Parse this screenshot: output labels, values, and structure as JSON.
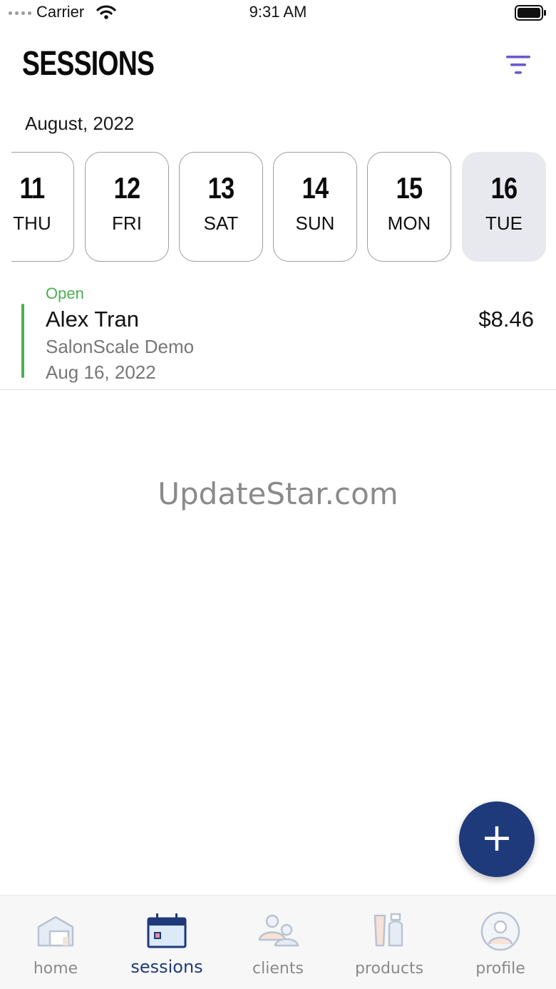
{
  "status_bar": {
    "carrier": "Carrier",
    "time": "9:31 AM"
  },
  "header": {
    "title": "SESSIONS",
    "filter_icon": "filter-icon",
    "accent_color": "#6a5acd"
  },
  "calendar": {
    "month": "August, 2022",
    "dates": [
      {
        "num": "11",
        "day": "THU",
        "selected": false
      },
      {
        "num": "12",
        "day": "FRI",
        "selected": false
      },
      {
        "num": "13",
        "day": "SAT",
        "selected": false
      },
      {
        "num": "14",
        "day": "SUN",
        "selected": false
      },
      {
        "num": "15",
        "day": "MON",
        "selected": false
      },
      {
        "num": "16",
        "day": "TUE",
        "selected": true
      }
    ]
  },
  "sessions": [
    {
      "status": "Open",
      "client": "Alex Tran",
      "salon": "SalonScale Demo",
      "date": "Aug 16, 2022",
      "amount": "$8.46",
      "status_color": "#4caf50"
    }
  ],
  "watermark": "UpdateStar.com",
  "fab": {
    "icon": "plus-icon",
    "color": "#1f3a7a"
  },
  "tab_bar": {
    "tabs": [
      {
        "label": "home",
        "icon": "home-icon",
        "active": false
      },
      {
        "label": "sessions",
        "icon": "calendar-icon",
        "active": true
      },
      {
        "label": "clients",
        "icon": "clients-icon",
        "active": false
      },
      {
        "label": "products",
        "icon": "products-icon",
        "active": false
      },
      {
        "label": "profile",
        "icon": "profile-icon",
        "active": false
      }
    ],
    "active_color": "#1f3a7a"
  }
}
